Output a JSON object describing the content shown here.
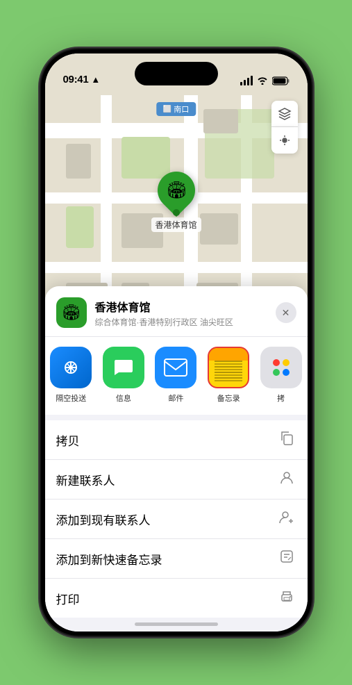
{
  "status_bar": {
    "time": "09:41",
    "location_arrow": "▸"
  },
  "map": {
    "north_label": "南口",
    "pin_emoji": "🏟",
    "location_name": "香港体育馆",
    "map_btn_layers": "🗺",
    "map_btn_location": "➤"
  },
  "location_header": {
    "icon_emoji": "🏟",
    "name": "香港体育馆",
    "subtitle": "综合体育馆·香港特别行政区 油尖旺区",
    "close": "✕"
  },
  "share_items": [
    {
      "id": "airdrop",
      "label": "隔空投送",
      "type": "airdrop"
    },
    {
      "id": "message",
      "label": "信息",
      "type": "message"
    },
    {
      "id": "mail",
      "label": "邮件",
      "type": "mail"
    },
    {
      "id": "notes",
      "label": "备忘录",
      "type": "notes"
    },
    {
      "id": "more",
      "label": "拷",
      "type": "more"
    }
  ],
  "actions": [
    {
      "label": "拷贝",
      "icon": "copy"
    },
    {
      "label": "新建联系人",
      "icon": "person"
    },
    {
      "label": "添加到现有联系人",
      "icon": "person-add"
    },
    {
      "label": "添加到新快速备忘录",
      "icon": "memo"
    },
    {
      "label": "打印",
      "icon": "print"
    }
  ]
}
